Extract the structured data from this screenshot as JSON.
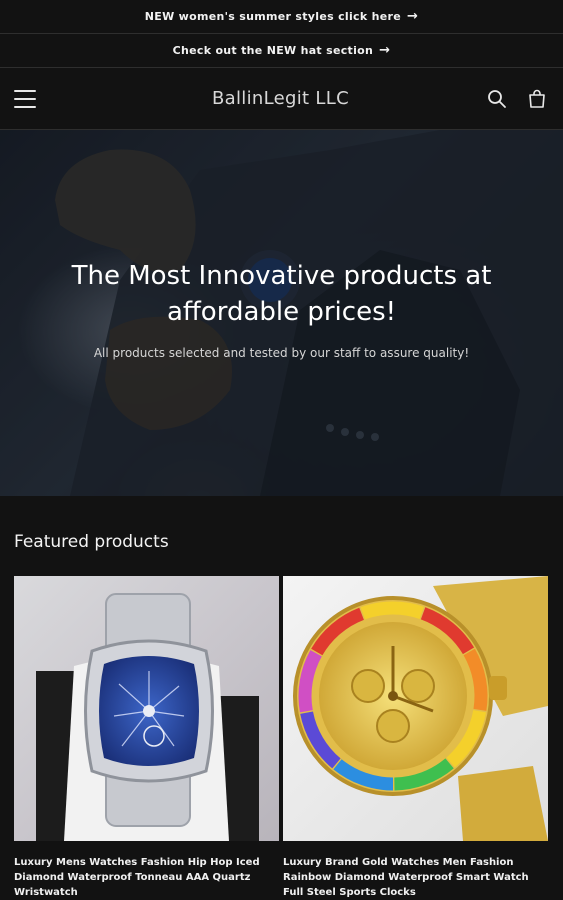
{
  "announcements": [
    {
      "text": "NEW women's summer styles click here",
      "arrow": "→"
    },
    {
      "text": "Check out the NEW hat section",
      "arrow": "→"
    }
  ],
  "header": {
    "store_name": "BallinLegit LLC"
  },
  "hero": {
    "title": "The Most Innovative products at affordable prices!",
    "subtitle": "All products selected and tested by our staff to assure quality!"
  },
  "featured": {
    "title": "Featured products",
    "products": [
      {
        "title": "Luxury Mens Watches Fashion Hip Hop Iced Diamond Waterproof Tonneau AAA Quartz Wristwatch"
      },
      {
        "title": "Luxury Brand Gold Watches Men Fashion Rainbow Diamond Waterproof Smart Watch Full Steel Sports Clocks"
      }
    ]
  },
  "colors": {
    "background": "#121212",
    "text": "#ffffff",
    "border": "#2e2e2e"
  }
}
